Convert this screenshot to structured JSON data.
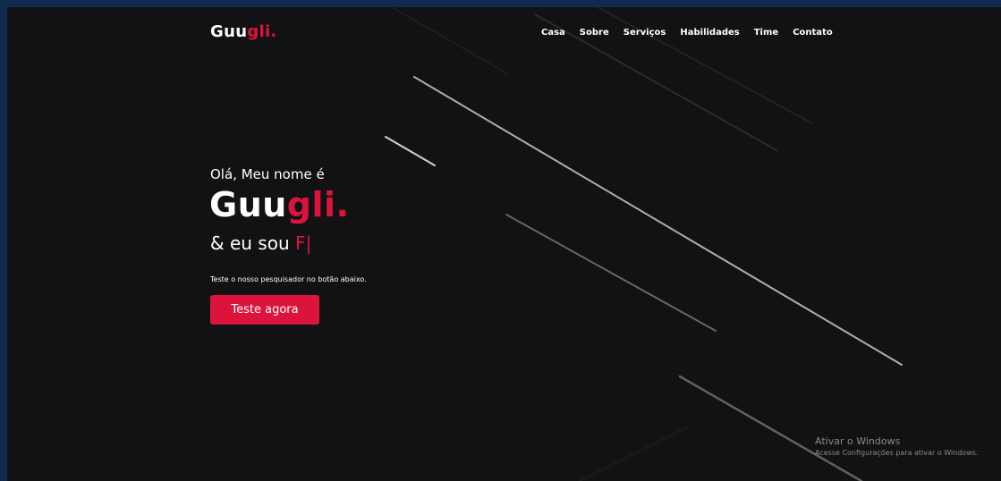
{
  "header": {
    "logo_main": "Guu",
    "logo_accent": "gli.",
    "nav": [
      {
        "label": "Casa"
      },
      {
        "label": "Sobre"
      },
      {
        "label": "Serviços"
      },
      {
        "label": "Habilidades"
      },
      {
        "label": "Time"
      },
      {
        "label": "Contato"
      }
    ]
  },
  "hero": {
    "greeting": "Olá, Meu nome é",
    "name_main": "Guu",
    "name_accent": "gli.",
    "role_prefix": "& eu sou ",
    "role_typed": "F",
    "caret": "|",
    "description": "Teste o nosso pesquisador no botão abaixo.",
    "cta_label": "Teste agora"
  },
  "windows_watermark": {
    "title": "Ativar o Windows",
    "subtitle": "Acesse Configurações para ativar o Windows."
  },
  "colors": {
    "accent": "#dc143c",
    "background": "#121214",
    "outer_frame": "#0f2a4e"
  }
}
